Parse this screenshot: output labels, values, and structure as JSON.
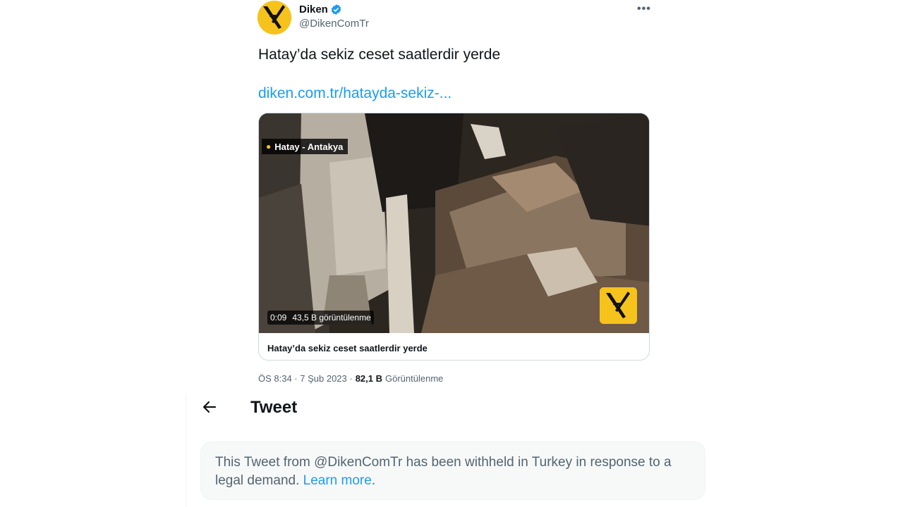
{
  "tweet": {
    "author_name": "Diken",
    "author_handle": "@DikenComTr",
    "more_label": "•••",
    "text": "Hatay’da sekiz ceset saatlerdir yerde",
    "link_text": "diken.com.tr/hatayda-sekiz-...",
    "card": {
      "location_tag": "Hatay - Antakya",
      "duration": "0:09",
      "video_views": "43,5 B görüntülenme",
      "title": "Hatay’da sekiz ceset saatlerdir yerde"
    },
    "meta": {
      "time_date": "ÖS 8:34 · 7 Şub 2023 ·",
      "views_count": "82,1 B",
      "views_label": "Görüntülenme"
    }
  },
  "header": {
    "title": "Tweet"
  },
  "withheld": {
    "message": "This Tweet from @DikenComTr has been withheld in Turkey in response to a legal demand. ",
    "learn_more": "Learn more",
    "trailing": "."
  },
  "colors": {
    "accent": "#1d9bf0",
    "brand_yellow": "#f6c21c",
    "muted_text": "#536471"
  },
  "icons": {
    "avatar": "diken-logo-icon",
    "verified": "verified-badge-icon",
    "back": "back-arrow-icon",
    "location": "location-pin-icon"
  }
}
